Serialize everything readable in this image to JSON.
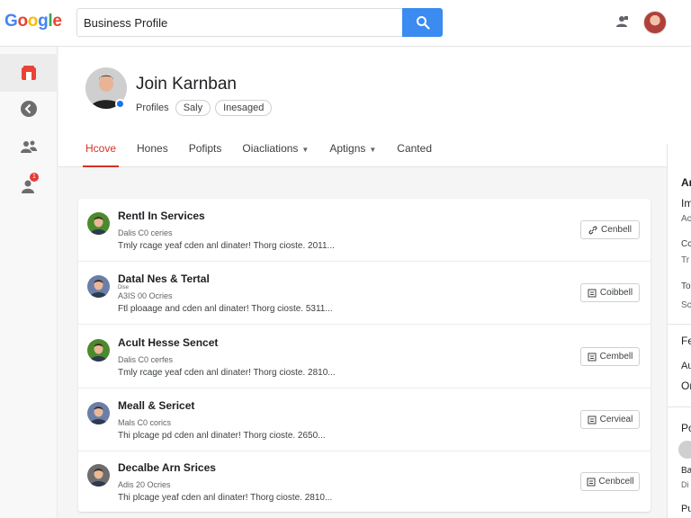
{
  "header": {
    "logo_letters": [
      "G",
      "o",
      "o",
      "g",
      "l",
      "e"
    ],
    "logo_colors": [
      "#4285f4",
      "#ea4335",
      "#fbbc05",
      "#4285f4",
      "#34a853",
      "#ea4335"
    ],
    "search_value": "Business Profile"
  },
  "rail": {
    "items": [
      {
        "icon": "store-icon",
        "active": true
      },
      {
        "icon": "back-icon",
        "active": false
      },
      {
        "icon": "people-icon",
        "active": false
      },
      {
        "icon": "person-icon",
        "active": false,
        "badge": "1"
      }
    ]
  },
  "profile": {
    "name": "Join Karnban",
    "label": "Profiles",
    "chips": [
      "Saly",
      "Inesaged"
    ]
  },
  "tabs": [
    {
      "label": "Hcove",
      "active": true,
      "dropdown": false
    },
    {
      "label": "Hones",
      "active": false,
      "dropdown": false
    },
    {
      "label": "Pofipts",
      "active": false,
      "dropdown": false
    },
    {
      "label": "Oiacliations",
      "active": false,
      "dropdown": true
    },
    {
      "label": "Aptigns",
      "active": false,
      "dropdown": true
    },
    {
      "label": "Canted",
      "active": false,
      "dropdown": false
    }
  ],
  "right_panel": {
    "lines": [
      "Ar",
      "Im",
      "Ac",
      "Cc",
      "Tr",
      "To",
      "Sc",
      "Fe",
      "Au",
      "Or",
      "Po",
      "Ba",
      "Di",
      "Pu"
    ]
  },
  "rows": [
    {
      "title": "Rentl In Services",
      "tiny": "",
      "sub": "Dalis C0 ceries",
      "desc": "Tmly rcage yeaf cden anl dinater! Thorg cioste. 2011...",
      "button": "Cenbell",
      "button_icon": "link-icon",
      "avatar_bg": "#4b8a2c"
    },
    {
      "title": "Datal Nes & Tertal",
      "tiny": "Dise",
      "sub": "A3IS 00 Ocries",
      "desc": "Ftl ploaage and cden anl dinater! Thorg cioste. 5311...",
      "button": "Coibbell",
      "button_icon": "list-icon",
      "avatar_bg": "#6a7fa8"
    },
    {
      "title": "Acult Hesse Sencet",
      "tiny": "",
      "sub": "Dalis C0 cerfes",
      "desc": "Tmly rcage yeaf cden anl dinater! Thorg cioste. 2810...",
      "button": "Cembell",
      "button_icon": "list-icon",
      "avatar_bg": "#4b8a2c"
    },
    {
      "title": "Meall & Sericet",
      "tiny": "",
      "sub": "Mals C0 corics",
      "desc": "Thi plcage pd cden anl dinater! Thorg cioste. 2650...",
      "button": "Cervieal",
      "button_icon": "list-icon",
      "avatar_bg": "#6a7fa8"
    },
    {
      "title": "Decalbe Arn Srices",
      "tiny": "",
      "sub": "Adis 20 Ocries",
      "desc": "Thi plcage yeaf cden anl dinater! Thorg cioste. 2810...",
      "button": "Cenbcell",
      "button_icon": "list-icon",
      "avatar_bg": "#6d6d6d"
    }
  ]
}
